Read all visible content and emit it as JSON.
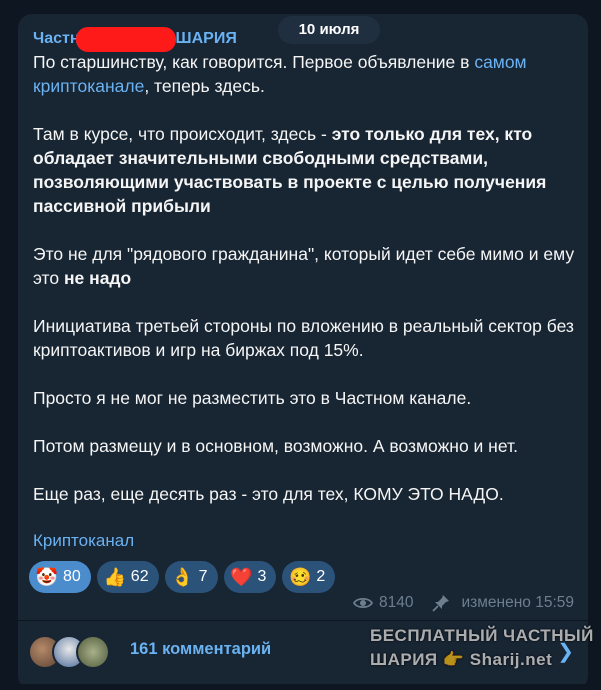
{
  "date_label": "10 июля",
  "post": {
    "author_prefix": "Частн",
    "author_suffix": "ШАРИЯ",
    "p1_a": "По старшинству, как говорится. Первое объявление в ",
    "p1_link": "самом криптоканале",
    "p1_b": ", теперь здесь.",
    "p2_a": "Там в курсе, что происходит, здесь - ",
    "p2_bold": "это только для тех, кто обладает значительными свободными средствами, позволяющими участвовать в проекте с целью получения пассивной прибыли",
    "p3_a": "Это не для \"рядового гражданина\", который идет себе мимо и ему это ",
    "p3_bold": "не надо",
    "p4": "Инициатива третьей стороны по вложению в реальный сектор без криптоактивов и игр на биржах под 15%.",
    "p5": "Просто я не мог не разместить это в Частном канале.",
    "p6": "Потом размещу и в основном, возможно. А возможно и нет.",
    "p7": "Еще раз, еще десять раз - это для тех, КОМУ ЭТО НАДО.",
    "signature": "Криптоканал"
  },
  "reactions": [
    {
      "icon": "clown-face",
      "emoji": "🤡",
      "count": "80",
      "active": true
    },
    {
      "icon": "thumbs-up",
      "emoji": "👍",
      "count": "62",
      "active": false
    },
    {
      "icon": "ok-hand",
      "emoji": "👌",
      "count": "7",
      "active": false
    },
    {
      "icon": "red-heart",
      "emoji": "❤️",
      "count": "3",
      "active": false
    },
    {
      "icon": "woozy-face",
      "emoji": "🥴",
      "count": "2",
      "active": false
    }
  ],
  "meta": {
    "views": "8140",
    "edited": "изменено 15:59"
  },
  "comments": {
    "label": "161 комментарий"
  },
  "watermark": {
    "line1": "БЕСПЛАТНЫЙ ЧАСТНЫЙ",
    "line2": "ШАРИЯ",
    "site": "Sharij.net"
  },
  "colors": {
    "background": "#0e1621",
    "bubble": "#182533",
    "link": "#6ab2f2",
    "reaction": "#2b5278",
    "reaction_active": "#4a8ccc",
    "redaction": "#ff1a1a"
  }
}
